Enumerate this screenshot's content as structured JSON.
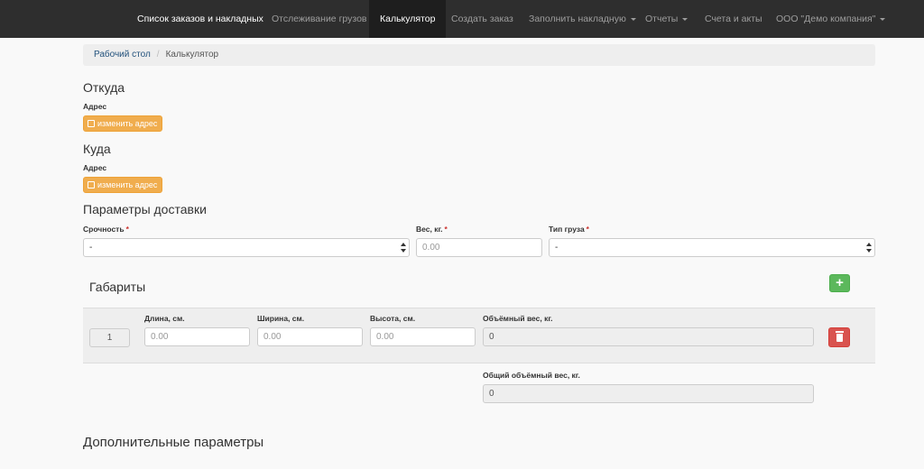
{
  "navbar": {
    "brand": "Список заказов и накладных",
    "items": [
      {
        "label": "Отслеживание грузов"
      },
      {
        "label": "Калькулятор"
      },
      {
        "label": "Создать заказ"
      },
      {
        "label": "Заполнить накладную"
      },
      {
        "label": "Отчеты"
      },
      {
        "label": "Счета и акты"
      },
      {
        "label": "ООО \"Демо компания\""
      }
    ]
  },
  "breadcrumb": {
    "home": "Рабочий стол",
    "separator": "/",
    "current": "Калькулятор"
  },
  "from": {
    "title": "Откуда",
    "address_label": "Адрес",
    "change_button": "изменить адрес"
  },
  "to": {
    "title": "Куда",
    "address_label": "Адрес",
    "change_button": "изменить адрес"
  },
  "delivery": {
    "title": "Параметры доставки",
    "urgency_label": "Срочность",
    "urgency_value": "-",
    "weight_label": "Вес, кг.",
    "weight_placeholder": "0.00",
    "cargo_type_label": "Тип груза",
    "cargo_type_value": "-",
    "required_mark": "*"
  },
  "dimensions": {
    "title": "Габариты",
    "add_button": "+",
    "row": {
      "index": "1",
      "length_label": "Длина, см.",
      "length_placeholder": "0.00",
      "width_label": "Ширина, см.",
      "width_placeholder": "0.00",
      "height_label": "Высота, см.",
      "height_placeholder": "0.00",
      "volume_label": "Объёмный вес, кг.",
      "volume_value": "0"
    },
    "total_label": "Общий объёмный вес, кг.",
    "total_value": "0"
  },
  "additional": {
    "title": "Дополнительные параметры"
  },
  "colors": {
    "navbar": "#2e2e2e",
    "warning": "#f0ad4e",
    "success": "#5cb85c",
    "danger": "#d9534f",
    "link": "#23527c"
  }
}
